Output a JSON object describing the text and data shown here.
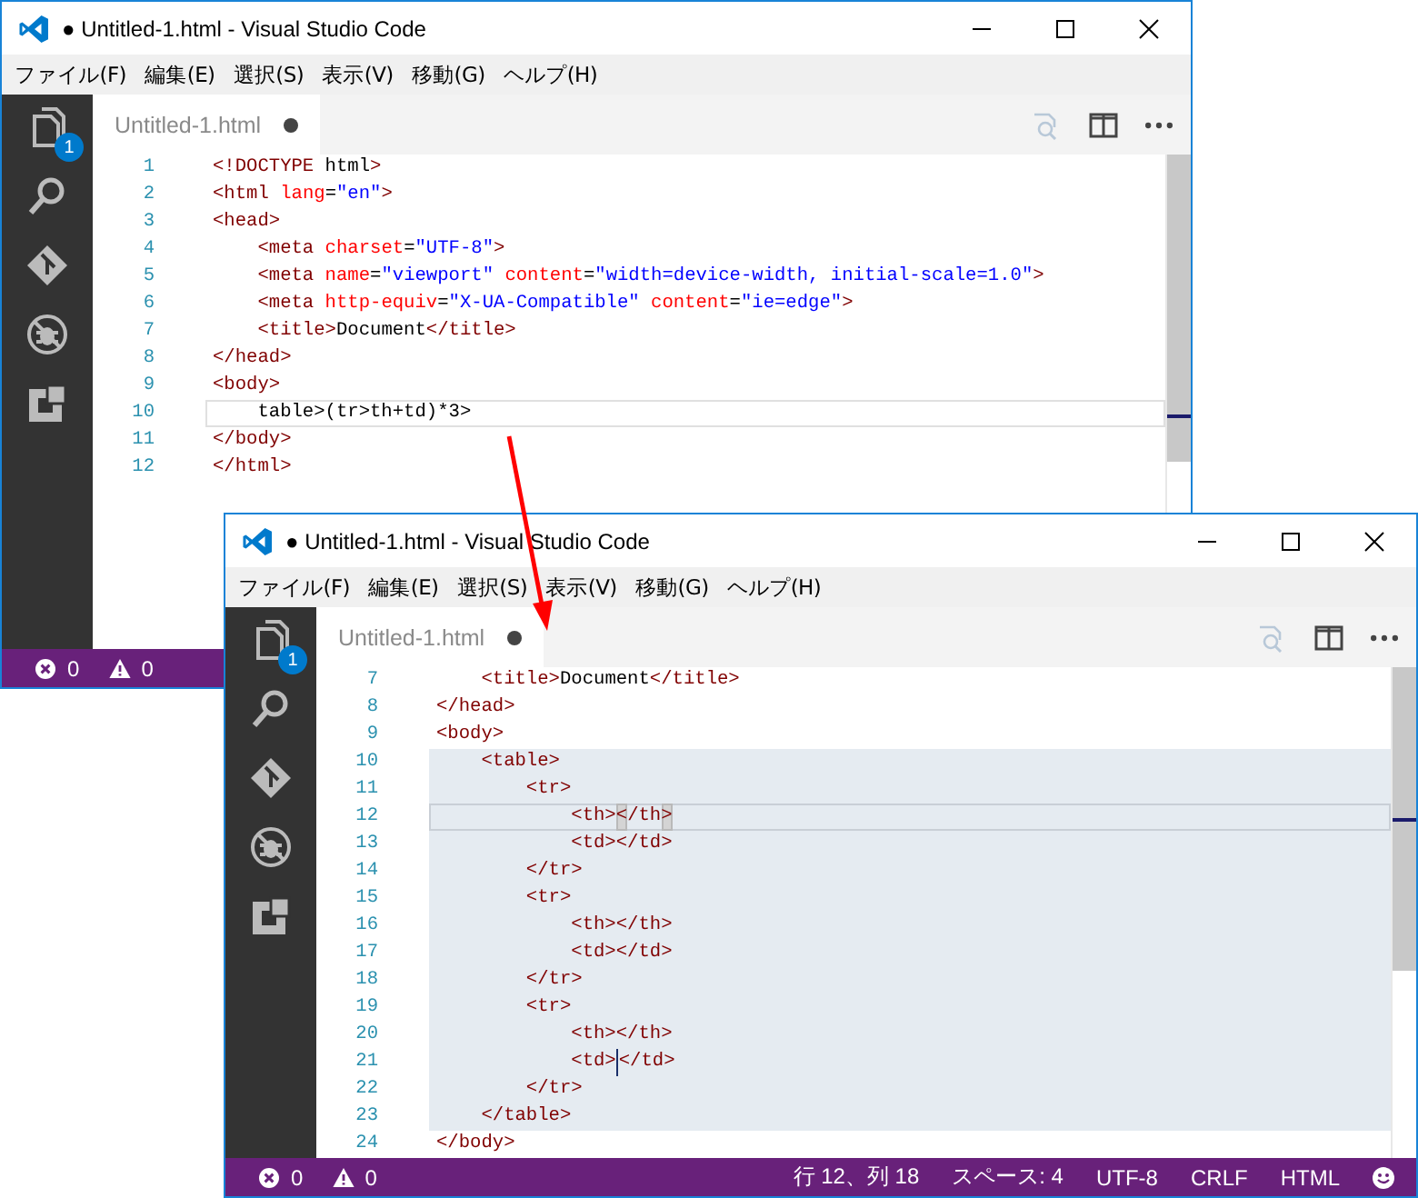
{
  "windows": [
    {
      "title": "● Untitled-1.html - Visual Studio Code",
      "menu": [
        "ファイル(F)",
        "編集(E)",
        "選択(S)",
        "表示(V)",
        "移動(G)",
        "ヘルプ(H)"
      ],
      "badge": "1",
      "tab": {
        "label": "Untitled-1.html",
        "dirty": true
      },
      "lines": [
        {
          "number": "1",
          "current": false,
          "selected": false,
          "caret": false,
          "tokens": [
            {
              "kind": "tag",
              "text": "<!DOCTYPE"
            },
            {
              "kind": "text",
              "text": " html"
            },
            {
              "kind": "tag",
              "text": ">"
            }
          ]
        },
        {
          "number": "2",
          "current": false,
          "selected": false,
          "caret": false,
          "tokens": [
            {
              "kind": "tag",
              "text": "<html"
            },
            {
              "kind": "attr",
              "text": " lang"
            },
            {
              "kind": "text",
              "text": "="
            },
            {
              "kind": "string",
              "text": "\"en\""
            },
            {
              "kind": "tag",
              "text": ">"
            }
          ]
        },
        {
          "number": "3",
          "current": false,
          "selected": false,
          "caret": false,
          "tokens": [
            {
              "kind": "tag",
              "text": "<head>"
            }
          ]
        },
        {
          "number": "4",
          "current": false,
          "selected": false,
          "caret": false,
          "tokens": [
            {
              "kind": "tag",
              "text": "    <meta"
            },
            {
              "kind": "attr",
              "text": " charset"
            },
            {
              "kind": "text",
              "text": "="
            },
            {
              "kind": "string",
              "text": "\"UTF-8\""
            },
            {
              "kind": "tag",
              "text": ">"
            }
          ]
        },
        {
          "number": "5",
          "current": false,
          "selected": false,
          "caret": false,
          "tokens": [
            {
              "kind": "tag",
              "text": "    <meta"
            },
            {
              "kind": "attr",
              "text": " name"
            },
            {
              "kind": "text",
              "text": "="
            },
            {
              "kind": "string",
              "text": "\"viewport\""
            },
            {
              "kind": "attr",
              "text": " content"
            },
            {
              "kind": "text",
              "text": "="
            },
            {
              "kind": "string",
              "text": "\"width=device-width, initial-scale=1.0\""
            },
            {
              "kind": "tag",
              "text": ">"
            }
          ]
        },
        {
          "number": "6",
          "current": false,
          "selected": false,
          "caret": false,
          "tokens": [
            {
              "kind": "tag",
              "text": "    <meta"
            },
            {
              "kind": "attr",
              "text": " http-equiv"
            },
            {
              "kind": "text",
              "text": "="
            },
            {
              "kind": "string",
              "text": "\"X-UA-Compatible\""
            },
            {
              "kind": "attr",
              "text": " content"
            },
            {
              "kind": "text",
              "text": "="
            },
            {
              "kind": "string",
              "text": "\"ie=edge\""
            },
            {
              "kind": "tag",
              "text": ">"
            }
          ]
        },
        {
          "number": "7",
          "current": false,
          "selected": false,
          "caret": false,
          "tokens": [
            {
              "kind": "tag",
              "text": "    <title>"
            },
            {
              "kind": "text",
              "text": "Document"
            },
            {
              "kind": "tag",
              "text": "</title>"
            }
          ]
        },
        {
          "number": "8",
          "current": false,
          "selected": false,
          "caret": false,
          "tokens": [
            {
              "kind": "tag",
              "text": "</head>"
            }
          ]
        },
        {
          "number": "9",
          "current": false,
          "selected": false,
          "caret": false,
          "tokens": [
            {
              "kind": "tag",
              "text": "<body>"
            }
          ]
        },
        {
          "number": "10",
          "current": true,
          "selected": false,
          "caret": false,
          "tokens": [
            {
              "kind": "text",
              "text": "    table>(tr>th+td)*3>"
            }
          ]
        },
        {
          "number": "11",
          "current": false,
          "selected": false,
          "caret": false,
          "tokens": [
            {
              "kind": "tag",
              "text": "</body>"
            }
          ]
        },
        {
          "number": "12",
          "current": false,
          "selected": false,
          "caret": false,
          "tokens": [
            {
              "kind": "tag",
              "text": "</html>"
            }
          ]
        }
      ],
      "status": {
        "errors": "0",
        "warnings": "0"
      }
    },
    {
      "title": "● Untitled-1.html - Visual Studio Code",
      "menu": [
        "ファイル(F)",
        "編集(E)",
        "選択(S)",
        "表示(V)",
        "移動(G)",
        "ヘルプ(H)"
      ],
      "badge": "1",
      "tab": {
        "label": "Untitled-1.html",
        "dirty": true
      },
      "lines": [
        {
          "number": "7",
          "current": false,
          "selected": false,
          "caret": false,
          "tokens": [
            {
              "kind": "tag",
              "text": "    <title>"
            },
            {
              "kind": "text",
              "text": "Document"
            },
            {
              "kind": "tag",
              "text": "</title>"
            }
          ]
        },
        {
          "number": "8",
          "current": false,
          "selected": false,
          "caret": false,
          "tokens": [
            {
              "kind": "tag",
              "text": "</head>"
            }
          ]
        },
        {
          "number": "9",
          "current": false,
          "selected": false,
          "caret": false,
          "tokens": [
            {
              "kind": "tag",
              "text": "<body>"
            }
          ]
        },
        {
          "number": "10",
          "current": false,
          "selected": true,
          "caret": false,
          "tokens": [
            {
              "kind": "tag",
              "text": "    <table>"
            }
          ]
        },
        {
          "number": "11",
          "current": false,
          "selected": true,
          "caret": false,
          "tokens": [
            {
              "kind": "tag",
              "text": "        <tr>"
            }
          ]
        },
        {
          "number": "12",
          "current": true,
          "selected": true,
          "caret": false,
          "tokens": [
            {
              "kind": "tag",
              "text": "            <th>"
            },
            {
              "kind": "match",
              "text": "<"
            },
            {
              "kind": "tag",
              "text": "/th"
            },
            {
              "kind": "match",
              "text": ">"
            }
          ]
        },
        {
          "number": "13",
          "current": false,
          "selected": true,
          "caret": false,
          "tokens": [
            {
              "kind": "tag",
              "text": "            <td></td>"
            }
          ]
        },
        {
          "number": "14",
          "current": false,
          "selected": true,
          "caret": false,
          "tokens": [
            {
              "kind": "tag",
              "text": "        </tr>"
            }
          ]
        },
        {
          "number": "15",
          "current": false,
          "selected": true,
          "caret": false,
          "tokens": [
            {
              "kind": "tag",
              "text": "        <tr>"
            }
          ]
        },
        {
          "number": "16",
          "current": false,
          "selected": true,
          "caret": false,
          "tokens": [
            {
              "kind": "tag",
              "text": "            <th></th>"
            }
          ]
        },
        {
          "number": "17",
          "current": false,
          "selected": true,
          "caret": false,
          "tokens": [
            {
              "kind": "tag",
              "text": "            <td></td>"
            }
          ]
        },
        {
          "number": "18",
          "current": false,
          "selected": true,
          "caret": false,
          "tokens": [
            {
              "kind": "tag",
              "text": "        </tr>"
            }
          ]
        },
        {
          "number": "19",
          "current": false,
          "selected": true,
          "caret": false,
          "tokens": [
            {
              "kind": "tag",
              "text": "        <tr>"
            }
          ]
        },
        {
          "number": "20",
          "current": false,
          "selected": true,
          "caret": false,
          "tokens": [
            {
              "kind": "tag",
              "text": "            <th></th>"
            }
          ]
        },
        {
          "number": "21",
          "current": false,
          "selected": true,
          "caret": true,
          "tokens": [
            {
              "kind": "tag",
              "text": "            <td>"
            },
            {
              "kind": "tag",
              "text": "</td>"
            }
          ]
        },
        {
          "number": "22",
          "current": false,
          "selected": true,
          "caret": false,
          "tokens": [
            {
              "kind": "tag",
              "text": "        </tr>"
            }
          ]
        },
        {
          "number": "23",
          "current": false,
          "selected": true,
          "caret": false,
          "tokens": [
            {
              "kind": "tag",
              "text": "    </table>"
            }
          ]
        },
        {
          "number": "24",
          "current": false,
          "selected": false,
          "caret": false,
          "tokens": [
            {
              "kind": "tag",
              "text": "</body>"
            }
          ]
        }
      ],
      "status": {
        "errors": "0",
        "warnings": "0",
        "items": [
          "行 12、列 18",
          "スペース: 4",
          "UTF-8",
          "CRLF",
          "HTML"
        ]
      }
    }
  ]
}
